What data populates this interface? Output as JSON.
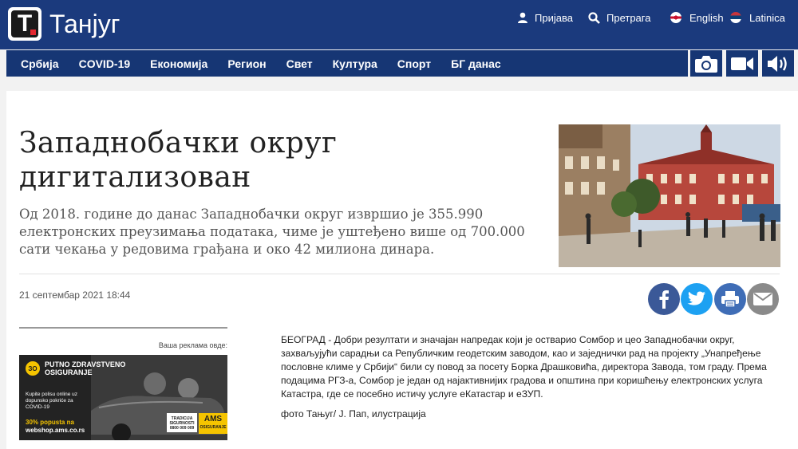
{
  "header": {
    "logo_letter": "T",
    "brand": "Танјуг",
    "login": "Пријава",
    "search": "Претрага",
    "lang_en": "English",
    "lang_latin": "Latinica",
    "nav": [
      "Србија",
      "COVID-19",
      "Економија",
      "Регион",
      "Свет",
      "Култура",
      "Спорт",
      "БГ данас"
    ],
    "media_icons": [
      "camera-icon",
      "video-icon",
      "audio-icon"
    ]
  },
  "article": {
    "title": "Западнобачки округ дигитализован",
    "lead": "Од 2018. године до данас Западнобачки округ извршио је 355.990 електронских преузимања података, чиме је уштеђено више од 700.000 сати чекања у редовима грађана и око 42 милиона динара.",
    "date": "21 септембар 2021 18:44",
    "body": "БЕОГРАД - Добри резултати и значајан напредак који је остварио Сомбор и цео Западнобачки округ, захваљујући сарадњи са Републичким геодетским заводом, као и заједнички рад на пројекту „Унапређење пословне климе у Србији“ били су повод за посету Борка Драшковића, директора Завода, том граду. Према подацима РГЗ-а, Сомбор је један од најактивнијих градова и општина при коришћењу електронских услуга Катастра, где се посебно истичу услуге еКатастар и еЗУП.",
    "credit": "фото Тањуг/ Ј. Пап, илустрација",
    "share_icons": [
      "facebook-icon",
      "twitter-icon",
      "print-icon",
      "email-icon"
    ]
  },
  "ad": {
    "label": "Ваша реклама овде:",
    "logo": "ЗО",
    "line1": "PUTNO ZDRAVSTVENO",
    "line2": "OSIGURANJE",
    "line3": "Kupite polisu online uz dopunsko pokriće za COVID-19",
    "promo": "30% popusta na",
    "url": "webshop.ams.co.rs",
    "badge": "TRADICIJA SIGURNOSTI 0800 009 009",
    "brand": "AMS",
    "brand_sub": "OSIGURANJE"
  },
  "colors": {
    "header_bg": "#1b3a7d",
    "nav_bg": "#163674",
    "facebook": "#3b5998",
    "twitter": "#1da1f2",
    "print": "#3f6db6",
    "email": "#8a8a8a",
    "ad_yellow": "#f5c400"
  }
}
